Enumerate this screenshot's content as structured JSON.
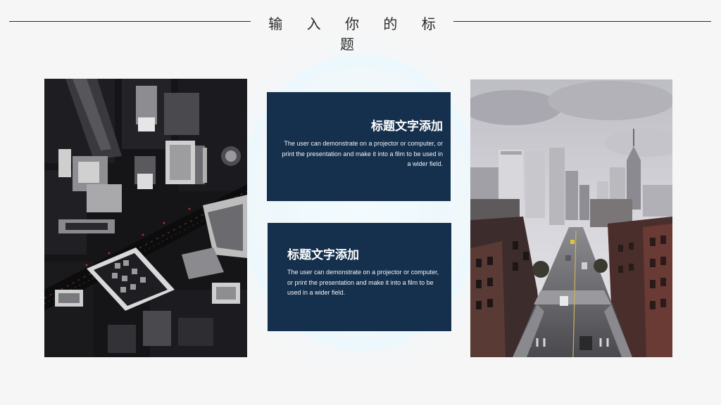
{
  "slide": {
    "title": "输 入 你 的 标 题",
    "cards": [
      {
        "heading": "标题文字添加",
        "body": "The user can demonstrate on a projector or computer, or print the presentation and make it into a film to be used in a wider field."
      },
      {
        "heading": "标题文字添加",
        "body": "The user can demonstrate on a projector or computer, or print the presentation and make it into a film to be used in a wider field."
      }
    ],
    "images": {
      "left": "aerial-city-night-photo",
      "right": "city-street-skyline-photo"
    }
  },
  "colors": {
    "background": "#f6f6f6",
    "card": "#15304d",
    "line": "#1a2e49",
    "title_text": "#2a2a2a",
    "glow": "#eef8fc"
  }
}
